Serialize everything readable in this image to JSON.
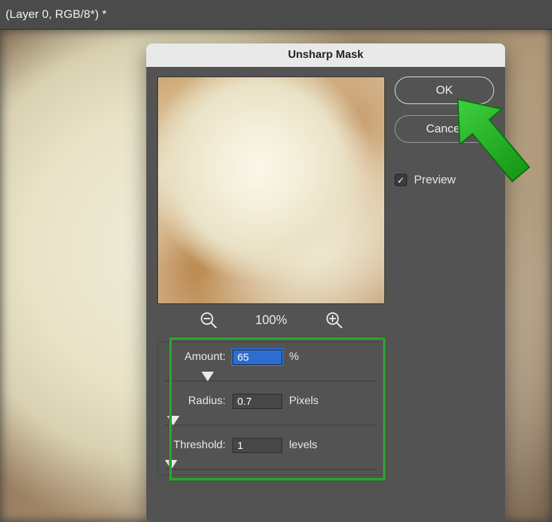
{
  "titlebar": {
    "text": "(Layer 0, RGB/8*) *"
  },
  "dialog": {
    "title": "Unsharp Mask",
    "ok_label": "OK",
    "cancel_label": "Cancel",
    "preview_label": "Preview",
    "preview_checked": true,
    "zoom_percent": "100%",
    "amount": {
      "label": "Amount:",
      "value": "65",
      "unit": "%",
      "slider_pct": 20
    },
    "radius": {
      "label": "Radius:",
      "value": "0.7",
      "unit": "Pixels",
      "slider_pct": 4
    },
    "threshold": {
      "label": "Threshold:",
      "value": "1",
      "unit": "levels",
      "slider_pct": 3
    }
  },
  "icons": {
    "zoom_out": "zoom-out-icon",
    "zoom_in": "zoom-in-icon",
    "check": "✓"
  }
}
